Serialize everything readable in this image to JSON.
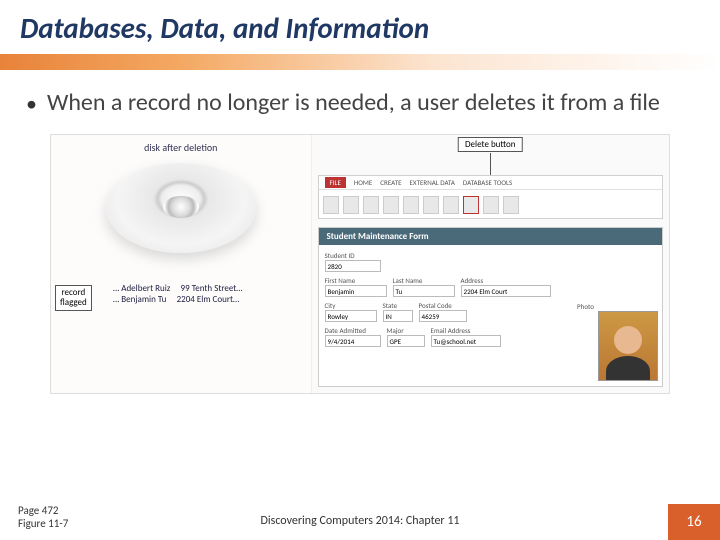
{
  "title": "Databases, Data, and Information",
  "bullet": "When a record no longer is needed, a user deletes it from a file",
  "figure": {
    "disk_label": "disk after deletion",
    "record_flag_label": "record\nflagged",
    "records": [
      {
        "name": "Adelbert Ruiz",
        "addr": "99 Tenth Street…"
      },
      {
        "name": "Benjamin Tu",
        "addr": "2204 Elm Court…"
      }
    ],
    "delete_callout": "Delete button",
    "ribbon_tabs": [
      "FILE",
      "HOME",
      "CREATE",
      "EXTERNAL DATA",
      "DATABASE TOOLS"
    ],
    "form_header": "Student Maintenance Form",
    "fields": {
      "student_id_lbl": "Student ID",
      "student_id": "2820",
      "first_lbl": "First Name",
      "first": "Benjamin",
      "last_lbl": "Last Name",
      "last": "Tu",
      "addr_lbl": "Address",
      "addr": "2204 Elm Court",
      "city_lbl": "City",
      "city": "Rowley",
      "state_lbl": "State",
      "state": "IN",
      "postal_lbl": "Postal Code",
      "postal": "46259",
      "da_lbl": "Date Admitted",
      "da": "9/4/2014",
      "major_lbl": "Major",
      "major": "GPE",
      "email_lbl": "Email Address",
      "email": "Tu@school.net",
      "photo_lbl": "Photo"
    }
  },
  "footer": {
    "page": "Page 472",
    "fig": "Figure 11-7",
    "chapter": "Discovering Computers 2014: Chapter 11",
    "slide": "16"
  }
}
